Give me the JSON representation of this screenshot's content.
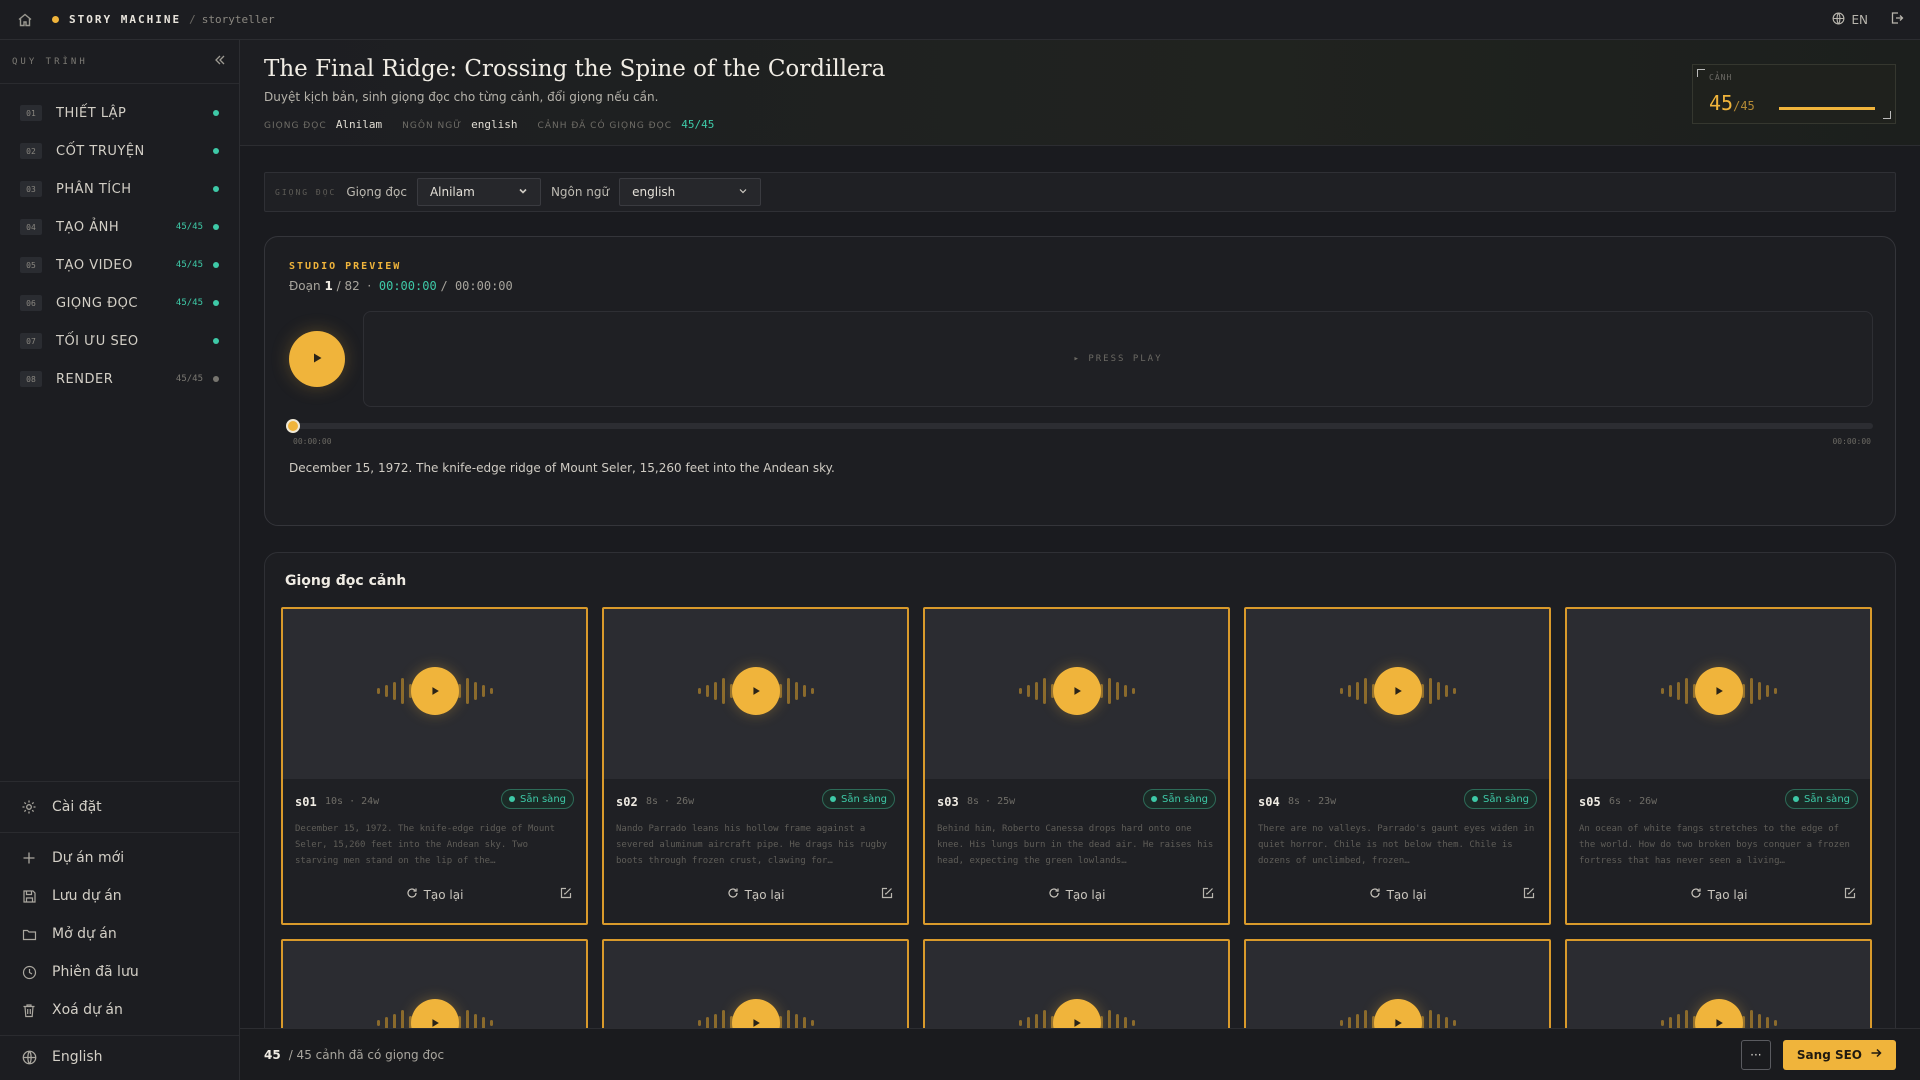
{
  "topbar": {
    "brand": "STORY MACHINE",
    "separator": "/",
    "crumb": "storyteller",
    "lang": "EN",
    "accent": "#f0b43b"
  },
  "sidebar": {
    "label": "QUY TRÌNH",
    "collapse_icon": "double-chevron-left-icon",
    "steps": [
      {
        "num": "01",
        "name": "THIẾT LẬP",
        "count": "",
        "status": "done"
      },
      {
        "num": "02",
        "name": "CỐT TRUYỆN",
        "count": "",
        "status": "done"
      },
      {
        "num": "03",
        "name": "PHÂN TÍCH",
        "count": "",
        "status": "done"
      },
      {
        "num": "04",
        "name": "TẠO ẢNH",
        "count": "45/45",
        "status": "done"
      },
      {
        "num": "05",
        "name": "TẠO VIDEO",
        "count": "45/45",
        "status": "done"
      },
      {
        "num": "06",
        "name": "GIỌNG ĐỌC",
        "count": "45/45",
        "status": "done"
      },
      {
        "num": "07",
        "name": "TỐI ƯU SEO",
        "count": "",
        "status": "done"
      },
      {
        "num": "08",
        "name": "RENDER",
        "count": "45/45",
        "status": "pending"
      }
    ],
    "bottom": [
      {
        "label": "Cài đặt",
        "icon": "gear-icon"
      },
      {
        "label": "Dự án mới",
        "icon": "plus-icon"
      },
      {
        "label": "Lưu dự án",
        "icon": "save-icon"
      },
      {
        "label": "Mở dự án",
        "icon": "folder-icon"
      },
      {
        "label": "Phiên đã lưu",
        "icon": "clock-icon"
      },
      {
        "label": "Xoá dự án",
        "icon": "trash-icon"
      },
      {
        "label": "English",
        "icon": "globe-icon"
      }
    ]
  },
  "header": {
    "title": "The Final Ridge: Crossing the Spine of the Cordillera",
    "subtitle": "Duyệt kịch bản, sinh giọng đọc cho từng cảnh, đổi giọng nếu cần.",
    "meta": {
      "voice_label": "GIỌNG ĐỌC",
      "voice_value": "Alnilam",
      "lang_label": "NGÔN NGỮ",
      "lang_value": "english",
      "scenes_label": "CẢNH ĐÃ CÓ GIỌNG ĐỌC",
      "scenes_value": "45/45"
    },
    "scene_box": {
      "label": "CẢNH",
      "value": "45",
      "total": "/45",
      "progress": 1.0
    }
  },
  "voicebar": {
    "tag": "GIỌNG ĐỌC",
    "voice_label": "Giọng đọc",
    "voice_value": "Alnilam",
    "lang_label": "Ngôn ngữ",
    "lang_value": "english"
  },
  "studio": {
    "heading": "STUDIO PREVIEW",
    "segment_label": "Đoạn",
    "segment_current": "1",
    "segment_total": "/ 82",
    "dot": "·",
    "time_current": "00:00:00",
    "time_total": "/ 00:00:00",
    "screen_text": "▸ PRESS PLAY",
    "time_start": "00:00:00",
    "time_end": "00:00:00",
    "caption": "December 15, 1972. The knife-edge ridge of Mount Seler, 15,260 feet into the Andean sky.",
    "progress": 0
  },
  "scenes": {
    "heading": "Giọng đọc cảnh",
    "regen_label": "Tạo lại",
    "status_label": "Sẵn sàng",
    "items": [
      {
        "id": "s01",
        "meta": "10s · 24w",
        "text": "December 15, 1972. The knife-edge ridge of Mount Seler, 15,260 feet into the Andean sky. Two starving men stand on the lip of the…"
      },
      {
        "id": "s02",
        "meta": "8s · 26w",
        "text": "Nando Parrado leans his hollow frame against a severed aluminum aircraft pipe. He drags his rugby boots through frozen crust, clawing for…"
      },
      {
        "id": "s03",
        "meta": "8s · 25w",
        "text": "Behind him, Roberto Canessa drops hard onto one knee. His lungs burn in the dead air. He raises his head, expecting the green lowlands…"
      },
      {
        "id": "s04",
        "meta": "8s · 23w",
        "text": "There are no valleys. Parrado's gaunt eyes widen in quiet horror. Chile is not below them. Chile is dozens of unclimbed, frozen…"
      },
      {
        "id": "s05",
        "meta": "6s · 26w",
        "text": "An ocean of white fangs stretches to the edge of the world. How do two broken boys conquer a frozen fortress that has never seen a living…"
      }
    ]
  },
  "footer": {
    "count": "45",
    "rest": "/ 45 cảnh đã có giọng đọc",
    "more": "···",
    "next": "Sang SEO"
  }
}
